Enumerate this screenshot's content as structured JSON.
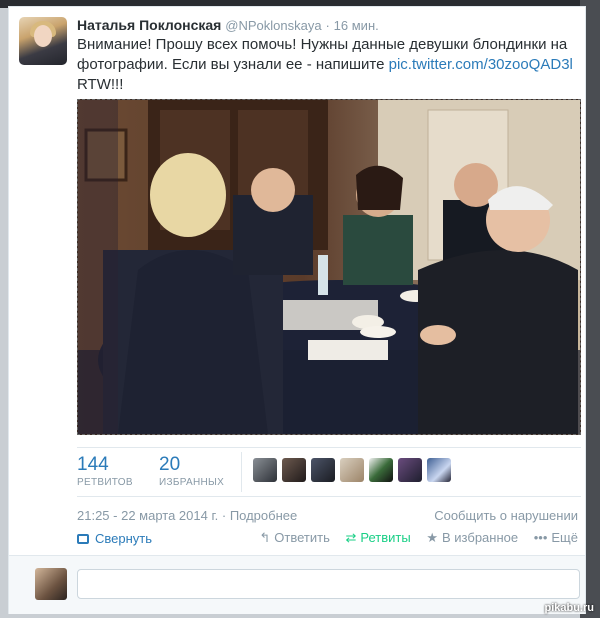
{
  "tweet": {
    "author_name": "Наталья Поклонская",
    "author_handle": "@NPoklonskaya",
    "separator": "·",
    "time": "16 мин.",
    "text": "Внимание! Прошу всех помочь! Нужны данные девушки блондинки на фотографии. Если вы узнали ее - напишите",
    "link": "pic.twitter.com/30zooQAD3l",
    "text_end": "RTW!!!"
  },
  "stats": {
    "retweets_count": "144",
    "retweets_label": "РЕТВИТОВ",
    "favorites_count": "20",
    "favorites_label": "ИЗБРАННЫХ"
  },
  "meta": {
    "timestamp": "21:25 - 22 марта 2014 г.",
    "separator": "·",
    "details_link": "Подробнее",
    "report_link": "Сообщить о нарушении"
  },
  "actions": {
    "collapse_label": "Свернуть",
    "reply_label": "Ответить",
    "retweet_label": "Ретвиты",
    "favorite_label": "В избранное",
    "more_label": "Ещё"
  },
  "icons": {
    "collapse": "collapse-icon",
    "reply": "reply-arrow-icon",
    "retweet": "retweet-icon",
    "favorite": "star-icon",
    "more": "ellipsis-icon"
  },
  "colors": {
    "link": "#2b7bb9",
    "retweet": "#19cf86",
    "muted": "#8899a6"
  },
  "watermark": "pikabu.ru"
}
